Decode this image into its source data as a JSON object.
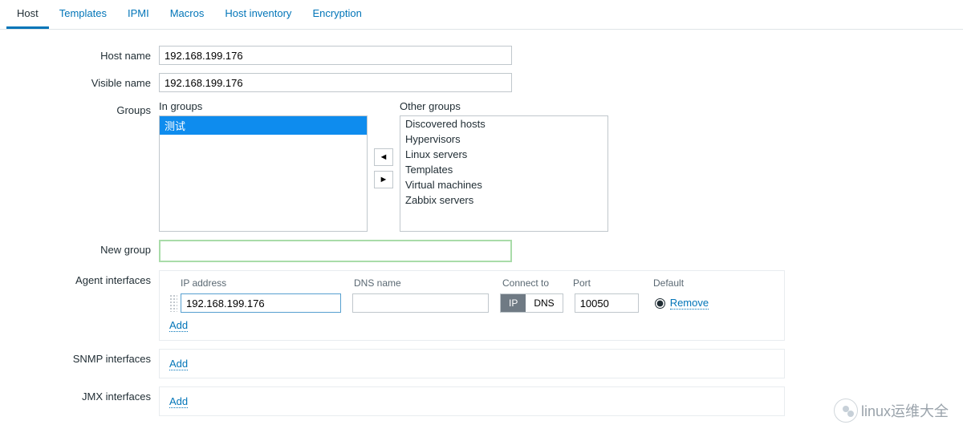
{
  "tabs": {
    "host": "Host",
    "templates": "Templates",
    "ipmi": "IPMI",
    "macros": "Macros",
    "inventory": "Host inventory",
    "encryption": "Encryption"
  },
  "labels": {
    "host_name": "Host name",
    "visible_name": "Visible name",
    "groups": "Groups",
    "in_groups": "In groups",
    "other_groups": "Other groups",
    "new_group": "New group",
    "agent_interfaces": "Agent interfaces",
    "snmp_interfaces": "SNMP interfaces",
    "jmx_interfaces": "JMX interfaces"
  },
  "values": {
    "host_name": "192.168.199.176",
    "visible_name": "192.168.199.176",
    "new_group": ""
  },
  "in_groups_items": [
    "测试"
  ],
  "other_groups_items": [
    "Discovered hosts",
    "Hypervisors",
    "Linux servers",
    "Templates",
    "Virtual machines",
    "Zabbix servers"
  ],
  "iface_headers": {
    "ip": "IP address",
    "dns": "DNS name",
    "connect": "Connect to",
    "port": "Port",
    "default": "Default"
  },
  "agent_row": {
    "ip": "192.168.199.176",
    "dns": "",
    "connect_ip": "IP",
    "connect_dns": "DNS",
    "port": "10050",
    "remove": "Remove"
  },
  "actions": {
    "add": "Add"
  },
  "watermark": "linux运维大全"
}
